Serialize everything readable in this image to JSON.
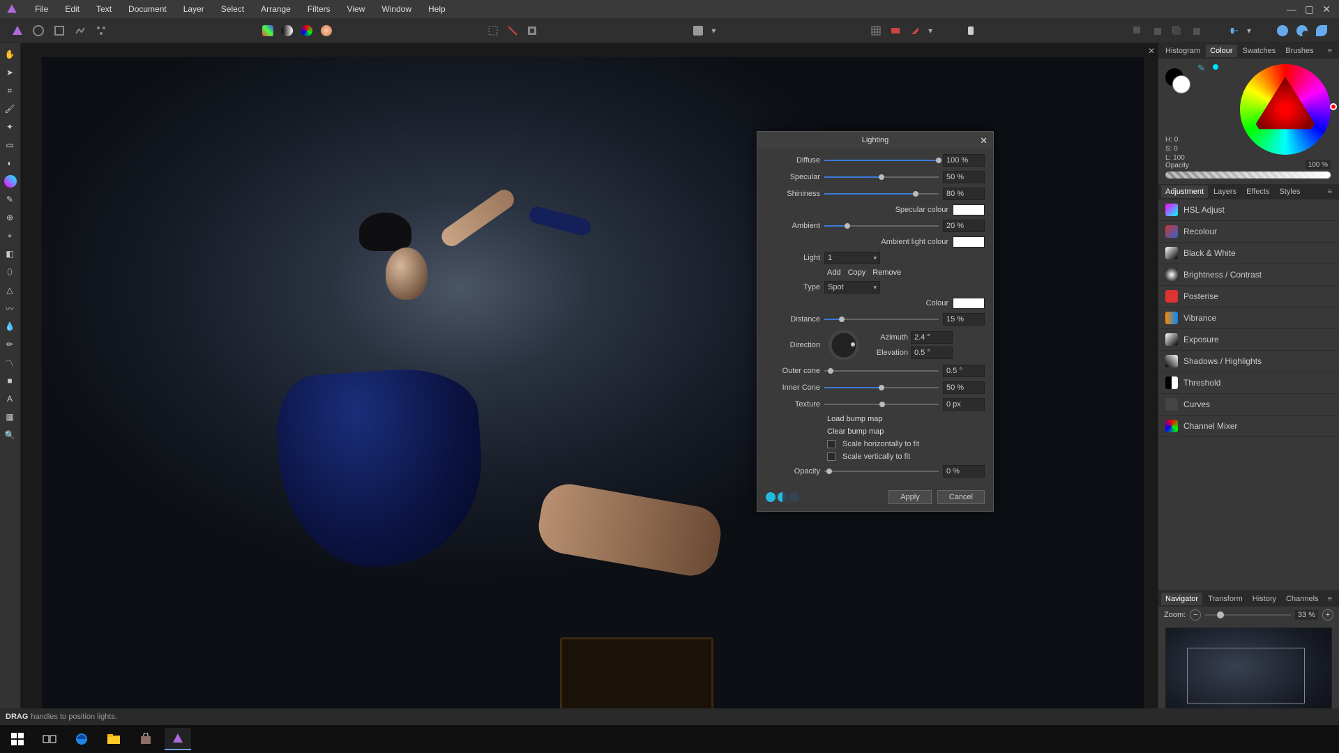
{
  "menu": [
    "File",
    "Edit",
    "Text",
    "Document",
    "Layer",
    "Select",
    "Arrange",
    "Filters",
    "View",
    "Window",
    "Help"
  ],
  "status": {
    "bold": "DRAG",
    "rest": "handles to position lights."
  },
  "panels": {
    "topTabs": [
      "Histogram",
      "Colour",
      "Swatches",
      "Brushes"
    ],
    "topActive": 1,
    "hsl": {
      "h": "H: 0",
      "s": "S: 0",
      "l": "L: 100"
    },
    "opacityLabel": "Opacity",
    "opacityValue": "100 %",
    "midTabs": [
      "Adjustment",
      "Layers",
      "Effects",
      "Styles"
    ],
    "midActive": 0,
    "adjustments": [
      {
        "label": "HSL Adjust",
        "color": "linear-gradient(135deg,#f0f,#0ff)"
      },
      {
        "label": "Recolour",
        "color": "linear-gradient(135deg,#c33,#36c)"
      },
      {
        "label": "Black & White",
        "color": "linear-gradient(135deg,#fff,#000)"
      },
      {
        "label": "Brightness / Contrast",
        "color": "radial-gradient(circle,#fff,#000)"
      },
      {
        "label": "Posterise",
        "color": "linear-gradient(90deg,#d33,#d33)"
      },
      {
        "label": "Vibrance",
        "color": "linear-gradient(90deg,#f80,#08f)"
      },
      {
        "label": "Exposure",
        "color": "linear-gradient(135deg,#fff,#000)"
      },
      {
        "label": "Shadows / Highlights",
        "color": "linear-gradient(45deg,#000,#fff)"
      },
      {
        "label": "Threshold",
        "color": "linear-gradient(90deg,#000 50%,#fff 50%)"
      },
      {
        "label": "Curves",
        "color": "#444"
      },
      {
        "label": "Channel Mixer",
        "color": "conic-gradient(red,lime,blue,red)"
      }
    ],
    "bottomTabs": [
      "Navigator",
      "Transform",
      "History",
      "Channels"
    ],
    "bottomActive": 0,
    "zoomLabel": "Zoom:",
    "zoomValue": "33 %"
  },
  "dialog": {
    "title": "Lighting",
    "diffuse": {
      "label": "Diffuse",
      "value": "100 %",
      "pct": 100
    },
    "specular": {
      "label": "Specular",
      "value": "50 %",
      "pct": 50
    },
    "shininess": {
      "label": "Shininess",
      "value": "80 %",
      "pct": 80
    },
    "specColourLabel": "Specular colour",
    "specColour": "#ffffff",
    "ambient": {
      "label": "Ambient",
      "value": "20 %",
      "pct": 20
    },
    "ambColourLabel": "Ambient light colour",
    "ambColour": "#ffffff",
    "lightLabel": "Light",
    "lightValue": "1",
    "add": "Add",
    "copy": "Copy",
    "remove": "Remove",
    "typeLabel": "Type",
    "typeValue": "Spot",
    "colourLabel": "Colour",
    "colour": "#ffffff",
    "distance": {
      "label": "Distance",
      "value": "15 %",
      "pct": 15
    },
    "directionLabel": "Direction",
    "azimuthLabel": "Azimuth",
    "azimuth": "2.4 °",
    "elevationLabel": "Elevation",
    "elevation": "0.5 °",
    "outerCone": {
      "label": "Outer cone",
      "value": "0.5 °",
      "pct": 3
    },
    "innerCone": {
      "label": "Inner Cone",
      "value": "50 %",
      "pct": 50
    },
    "texture": {
      "label": "Texture",
      "value": "0 px",
      "pct": 48
    },
    "loadBump": "Load bump map",
    "clearBump": "Clear bump map",
    "scaleH": "Scale horizontally to fit",
    "scaleV": "Scale vertically to fit",
    "opacity": {
      "label": "Opacity",
      "value": "0 %",
      "pct": 2
    },
    "apply": "Apply",
    "cancel": "Cancel"
  },
  "taskbar": {
    "buttons": [
      "start",
      "task-view",
      "edge",
      "explorer",
      "store",
      "affinity"
    ]
  }
}
